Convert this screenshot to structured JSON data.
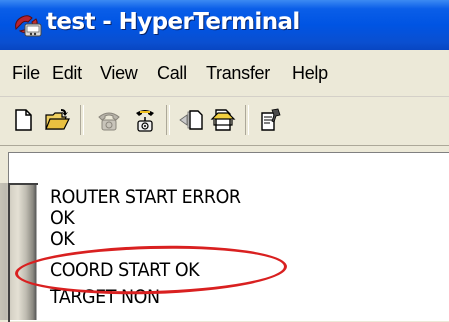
{
  "window": {
    "title": "test - HyperTerminal",
    "icon": "hyperterminal-app-icon"
  },
  "menu": {
    "items": [
      "File",
      "Edit",
      "View",
      "Call",
      "Transfer",
      "Help"
    ]
  },
  "toolbar": {
    "buttons": [
      "new-document-icon",
      "open-folder-icon",
      "phone-call-icon",
      "disconnect-icon",
      "send-file-icon",
      "receive-file-icon",
      "properties-icon"
    ]
  },
  "terminal": {
    "lines": [
      "ROUTER START ERROR",
      "OK",
      "OK",
      "COORD START OK",
      "TARGET NON"
    ]
  },
  "colors": {
    "titlebar": "#0054e3",
    "highlight_ellipse": "#d92020",
    "chrome": "#ece9d8"
  }
}
